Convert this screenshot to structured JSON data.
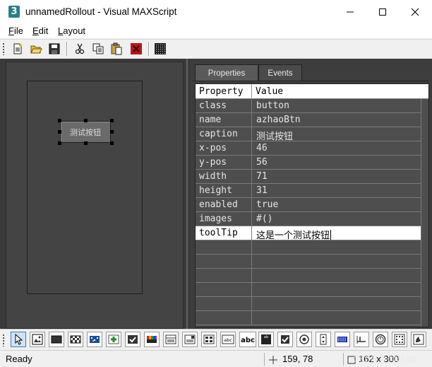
{
  "window": {
    "title": "unnamedRollout - Visual MAXScript",
    "icon_glyph": "3",
    "controls": [
      "minimize-icon",
      "maximize-icon",
      "close-icon"
    ]
  },
  "menu": {
    "items": [
      {
        "label": "File",
        "mnemonic": "F",
        "rest": "ile"
      },
      {
        "label": "Edit",
        "mnemonic": "E",
        "rest": "dit"
      },
      {
        "label": "Layout",
        "mnemonic": "L",
        "rest": "ayout"
      }
    ]
  },
  "toolbar": {
    "buttons": [
      "new-icon",
      "open-icon",
      "save-icon",
      "cut-icon",
      "copy-icon",
      "paste-icon",
      "delete-icon",
      "grid-icon"
    ]
  },
  "design": {
    "button_caption": "测试按钮"
  },
  "tabs": [
    {
      "label": "Properties",
      "active": true
    },
    {
      "label": "Events",
      "active": false
    }
  ],
  "properties": {
    "header": {
      "property": "Property",
      "value": "Value"
    },
    "rows": [
      {
        "name": "class",
        "value": "button"
      },
      {
        "name": "name",
        "value": "azhaoBtn"
      },
      {
        "name": "caption",
        "value": "测试按钮"
      },
      {
        "name": "x-pos",
        "value": "46"
      },
      {
        "name": "y-pos",
        "value": "56"
      },
      {
        "name": "width",
        "value": "71"
      },
      {
        "name": "height",
        "value": "31"
      },
      {
        "name": "enabled",
        "value": "true"
      },
      {
        "name": "images",
        "value": "#()"
      },
      {
        "name": "toolTip",
        "value": "这是一个测试按钮",
        "selected": true
      }
    ]
  },
  "control_toolbar": {
    "buttons": [
      "pointer-icon",
      "bitmap-icon",
      "button-icon",
      "checkerbutton-icon",
      "colorpicker-icon",
      "mapbutton-icon",
      "checkbox-button-icon",
      "color-swatch-icon",
      "combobox-icon",
      "dropdownlist-icon",
      "listbox-icon",
      "edittext-icon",
      "label-icon",
      "groupbox-icon",
      "checkbox-icon",
      "radiobutton-icon",
      "spinner-icon",
      "progressbar-icon",
      "slider-icon",
      "timer-icon",
      "activex-icon",
      "imgtag-icon"
    ],
    "label_text": {
      "edittext": "abc",
      "label": "abc",
      "groupbox": "ab"
    }
  },
  "status": {
    "text": "Ready",
    "coords": "159, 78",
    "size": "162 x 300",
    "watermark": "CSDN @阿赵3D"
  },
  "colors": {
    "accent": "#3c7fb1",
    "panel_dark": "#3d3d3d",
    "grid_bg": "#4e4e4e"
  }
}
